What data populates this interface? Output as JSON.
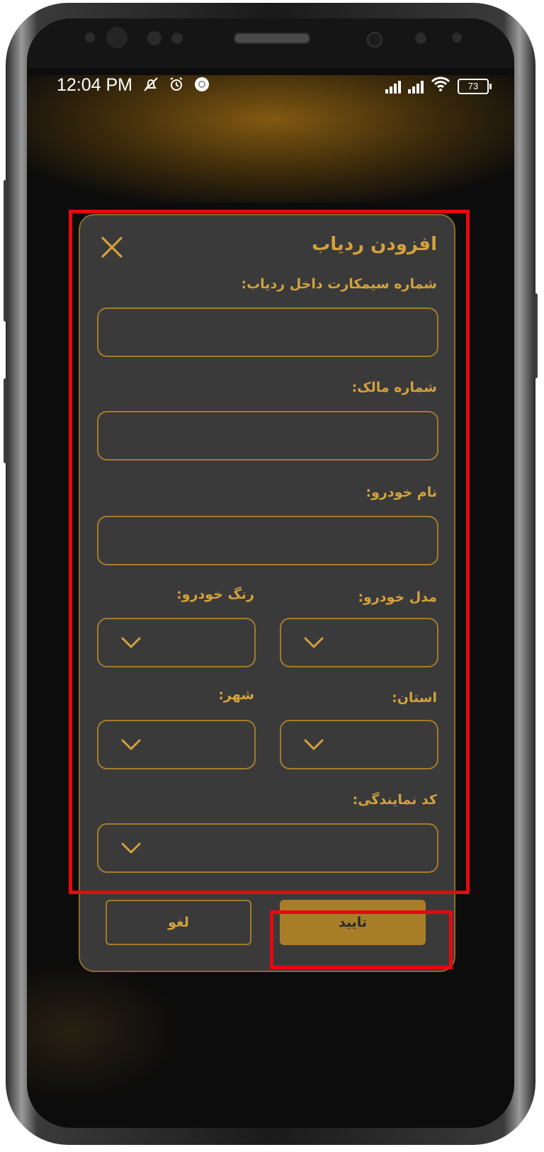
{
  "status_bar": {
    "time": "12:04 PM",
    "battery": "73",
    "icons_left": [
      "muted-icon",
      "alarm-icon",
      "chrome-icon"
    ],
    "icons_right": [
      "signal-icon",
      "signal-icon",
      "wifi-icon",
      "battery-icon"
    ]
  },
  "dialog": {
    "title": "افزودن ردیاب",
    "close_icon": "close-icon",
    "fields": {
      "sim_number": {
        "label": "شماره سیمکارت داخل ردیاب:",
        "value": ""
      },
      "owner_number": {
        "label": "شماره مالک:",
        "value": ""
      },
      "car_name": {
        "label": "نام خودرو:",
        "value": ""
      },
      "car_model": {
        "label": "مدل خودرو:",
        "value": ""
      },
      "car_color": {
        "label": "رنگ خودرو:",
        "value": ""
      },
      "province": {
        "label": "استان:",
        "value": ""
      },
      "city": {
        "label": "شهر:",
        "value": ""
      },
      "agency_code": {
        "label": "کد نمایندگی:",
        "value": ""
      }
    },
    "confirm_label": "تایید",
    "cancel_label": "لغو"
  },
  "colors": {
    "accent": "#d3a13d",
    "border": "#a57c2c",
    "confirm_bg": "#a87d28",
    "dialog_bg": "#3a3a3a",
    "annotation": "#e8080f"
  }
}
